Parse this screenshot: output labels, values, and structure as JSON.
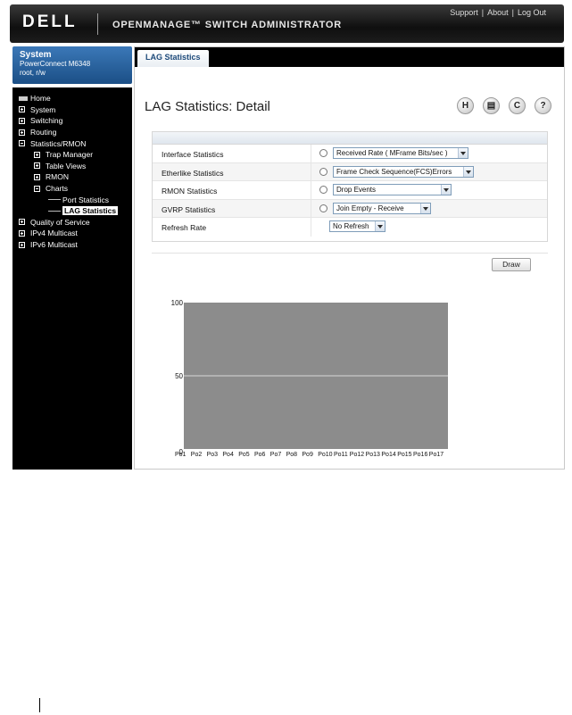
{
  "header": {
    "logo": "DELL",
    "app_title": "OPENMANAGE™ SWITCH ADMINISTRATOR",
    "links": [
      "Support",
      "About",
      "Log Out"
    ]
  },
  "system_panel": {
    "title": "System",
    "model": "PowerConnect M6348",
    "user": "root, r/w"
  },
  "nav": {
    "items": [
      {
        "label": "Home",
        "level": 0,
        "icon": "home-icon"
      },
      {
        "label": "System",
        "level": 0,
        "icon": "expand-icon"
      },
      {
        "label": "Switching",
        "level": 0,
        "icon": "expand-icon"
      },
      {
        "label": "Routing",
        "level": 0,
        "icon": "expand-icon"
      },
      {
        "label": "Statistics/RMON",
        "level": 0,
        "icon": "collapse-icon"
      },
      {
        "label": "Trap Manager",
        "level": 1,
        "icon": "expand-icon"
      },
      {
        "label": "Table Views",
        "level": 1,
        "icon": "expand-icon"
      },
      {
        "label": "RMON",
        "level": 1,
        "icon": "expand-icon"
      },
      {
        "label": "Charts",
        "level": 1,
        "icon": "collapse-icon"
      },
      {
        "label": "Port Statistics",
        "level": 2,
        "icon": "tree-line-icon"
      },
      {
        "label": "LAG Statistics",
        "level": 2,
        "icon": "tree-line-icon",
        "selected": true
      },
      {
        "label": "Quality of Service",
        "level": 0,
        "icon": "expand-icon"
      },
      {
        "label": "IPv4 Multicast",
        "level": 0,
        "icon": "expand-icon"
      },
      {
        "label": "IPv6 Multicast",
        "level": 0,
        "icon": "expand-icon"
      }
    ]
  },
  "tabs": [
    {
      "label": "LAG Statistics",
      "active": true
    }
  ],
  "page": {
    "title": "LAG Statistics: Detail",
    "tools": [
      {
        "icon": "save-icon",
        "glyph": "H"
      },
      {
        "icon": "print-icon",
        "glyph": "▤"
      },
      {
        "icon": "refresh-icon",
        "glyph": "C"
      },
      {
        "icon": "help-icon",
        "glyph": "?"
      }
    ]
  },
  "settings": {
    "rows": [
      {
        "label": "Interface Statistics",
        "radio": true,
        "value": "Received Rate ( MFrame Bits/sec )"
      },
      {
        "label": "Etherlike Statistics",
        "radio": true,
        "value": "Frame Check Sequence(FCS)Errors"
      },
      {
        "label": "RMON Statistics",
        "radio": true,
        "value": "Drop Events"
      },
      {
        "label": "GVRP Statistics",
        "radio": true,
        "value": "Join Empty - Receive"
      },
      {
        "label": "Refresh Rate",
        "radio": false,
        "value": "No Refresh"
      }
    ],
    "draw_label": "Draw"
  },
  "chart_data": {
    "type": "bar",
    "categories": [
      "Po1",
      "Po2",
      "Po3",
      "Po4",
      "Po5",
      "Po6",
      "Po7",
      "Po8",
      "Po9",
      "Po10",
      "Po11",
      "Po12",
      "Po13",
      "Po14",
      "Po15",
      "Po16",
      "Po17"
    ],
    "values": [
      0,
      0,
      0,
      0,
      0,
      0,
      0,
      0,
      0,
      0,
      0,
      0,
      0,
      0,
      0,
      0,
      0
    ],
    "ylim": [
      0,
      100
    ],
    "yticks": [
      0,
      50,
      100
    ],
    "plot_background": "#8c8c8c",
    "gridline_color": "#d9d9d9",
    "title": "",
    "xlabel": "",
    "ylabel": ""
  }
}
